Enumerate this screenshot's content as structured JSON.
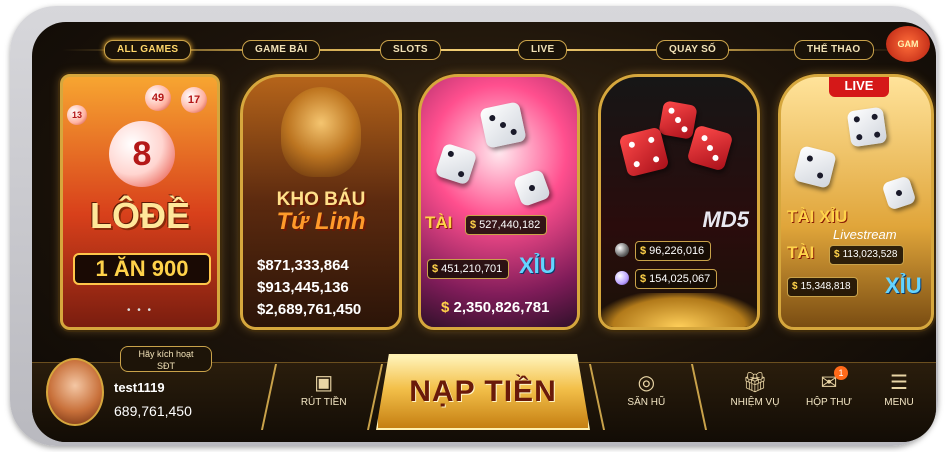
{
  "nav": {
    "tabs": [
      {
        "label": "ALL GAMES",
        "active": true
      },
      {
        "label": "GAME BÀI"
      },
      {
        "label": "SLOTS"
      },
      {
        "label": "LIVE"
      },
      {
        "label": "QUAY SỐ"
      },
      {
        "label": "THỂ THAO"
      }
    ],
    "corner_badge": "GAM"
  },
  "cards": {
    "lode": {
      "ball_number": "8",
      "small_balls": [
        "49",
        "17",
        "13"
      ],
      "title": "LÔĐỀ",
      "subtitle": "1 ĂN 900",
      "pager": "• • •"
    },
    "khobau": {
      "title_line1": "KHO BÁU",
      "title_line2": "Tứ Linh",
      "jackpots": [
        "$871,333,864",
        "$913,445,136",
        "$2,689,761,450"
      ]
    },
    "taixiu": {
      "tai": "TÀI",
      "xiu": "XỈU",
      "tai_amount": "527,440,182",
      "xiu_amount": "451,210,701",
      "total": "2,350,826,781"
    },
    "md5": {
      "label": "MD5",
      "amount1": "96,226,016",
      "amount2": "154,025,067"
    },
    "livestream": {
      "live_badge": "LIVE",
      "title": "TÀI XỈU",
      "stream_label": "Livestream",
      "tai": "TÀI",
      "xiu": "XỈU",
      "tai_amount": "113,023,528",
      "xiu_amount": "15,348,818"
    }
  },
  "currency_symbol": "$",
  "user": {
    "activate_line1": "Hãy kích hoạt",
    "activate_line2": "SĐT",
    "name": "test1119",
    "balance": "689,761,450"
  },
  "bottom_bar": {
    "withdraw": "RÚT TIỀN",
    "deposit": "NẠP TIỀN",
    "fish": "SĂN HŨ",
    "missions": "NHIỆM VỤ",
    "inbox": "HỘP THƯ",
    "inbox_count": "1",
    "menu": "MENU"
  },
  "icons": {
    "withdraw": "atm-icon",
    "fish": "jackpot-icon",
    "missions": "gift-icon",
    "inbox": "mail-icon",
    "menu": "hamburger-icon"
  }
}
